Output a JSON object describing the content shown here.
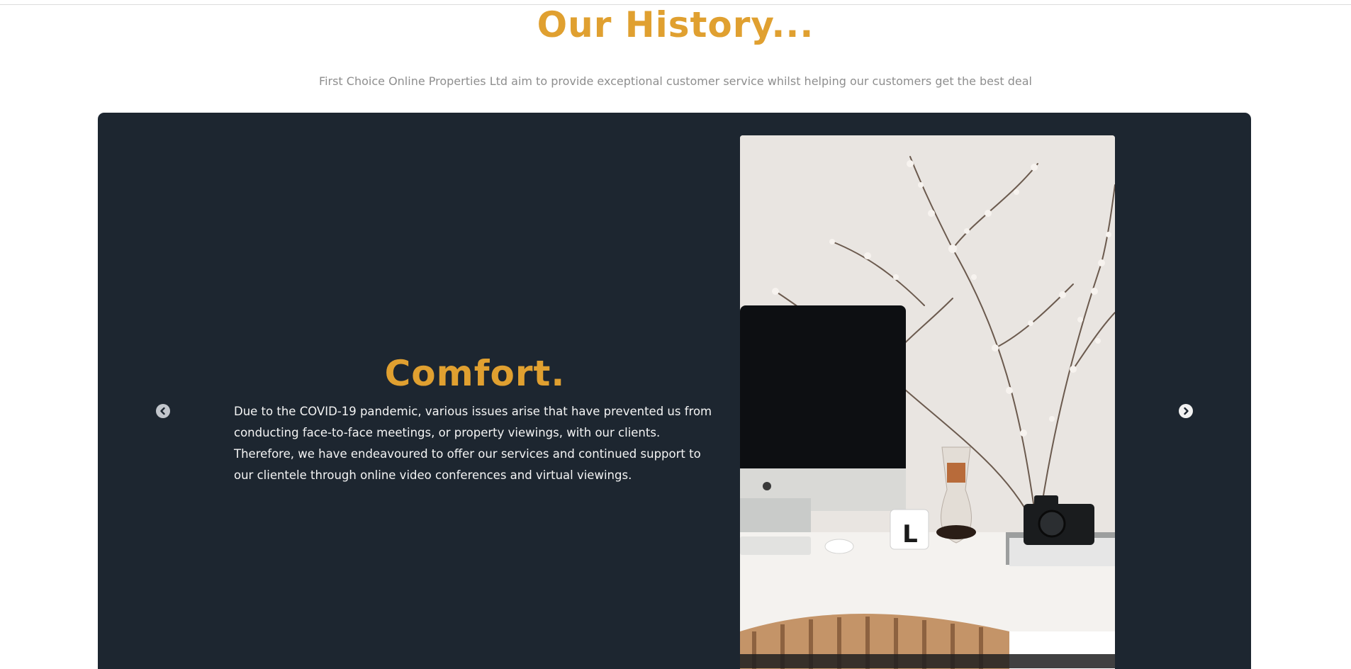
{
  "header": {
    "title": "Our History...",
    "subtitle": "First Choice Online Properties Ltd aim to provide exceptional customer service whilst helping our customers get the best deal"
  },
  "slider": {
    "prev_icon": "chevron-left-circle-icon",
    "next_icon": "chevron-right-circle-icon",
    "slide": {
      "heading": "Comfort.",
      "body": "Due to the COVID-19 pandemic, various issues arise that have prevented us from conducting face-to-face meetings, or property viewings, with our clients. Therefore, we have endeavoured to offer our services and continued support to our clientele through online video conferences and virtual viewings.",
      "image": {
        "name": "desk-with-computer-flowers-and-chair-photo",
        "keyboard_key_letter": "L"
      }
    }
  },
  "colors": {
    "accent": "#e0a030",
    "panel": "#1d2630",
    "subtitle_text": "#8e8e8e",
    "panel_text": "#f4f4f4"
  }
}
